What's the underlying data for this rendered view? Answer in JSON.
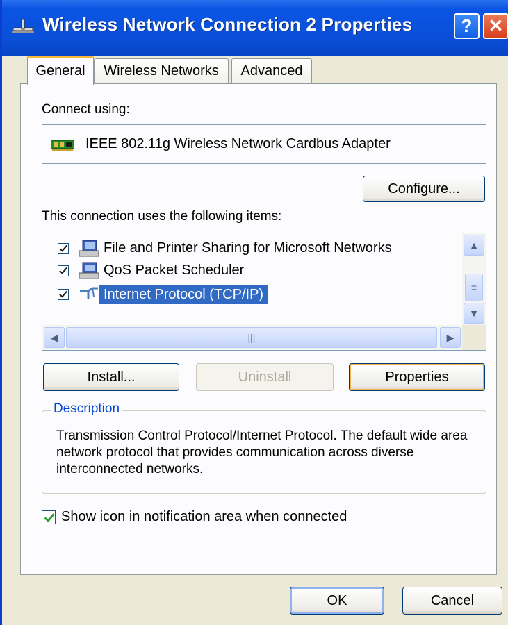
{
  "window": {
    "title": "Wireless Network Connection 2 Properties",
    "help_glyph": "?",
    "close_glyph": "✕",
    "titlebar_color": "#0a4fd8"
  },
  "tabs": [
    {
      "label": "General",
      "active": true
    },
    {
      "label": "Wireless Networks",
      "active": false
    },
    {
      "label": "Advanced",
      "active": false
    }
  ],
  "general": {
    "connect_using_label": "Connect using:",
    "adapter": {
      "name": "IEEE 802.11g Wireless Network Cardbus Adapter",
      "icon": "network-adapter-icon"
    },
    "configure_button": "Configure...",
    "items_label": "This connection uses the following items:",
    "items": [
      {
        "label": "File and Printer Sharing for Microsoft Networks",
        "checked": true,
        "icon": "network-service-icon",
        "selected": false
      },
      {
        "label": "QoS Packet Scheduler",
        "checked": true,
        "icon": "network-service-icon",
        "selected": false
      },
      {
        "label": "Internet Protocol (TCP/IP)",
        "checked": true,
        "icon": "protocol-icon",
        "selected": true
      }
    ],
    "install_button": "Install...",
    "uninstall_button": "Uninstall",
    "properties_button": "Properties",
    "description_title": "Description",
    "description_text": "Transmission Control Protocol/Internet Protocol. The default wide area network protocol that provides communication across diverse interconnected networks.",
    "show_icon_label": "Show icon in notification area when connected",
    "show_icon_checked": true,
    "selection_color": "#316ac5"
  },
  "footer": {
    "ok_button": "OK",
    "cancel_button": "Cancel"
  }
}
